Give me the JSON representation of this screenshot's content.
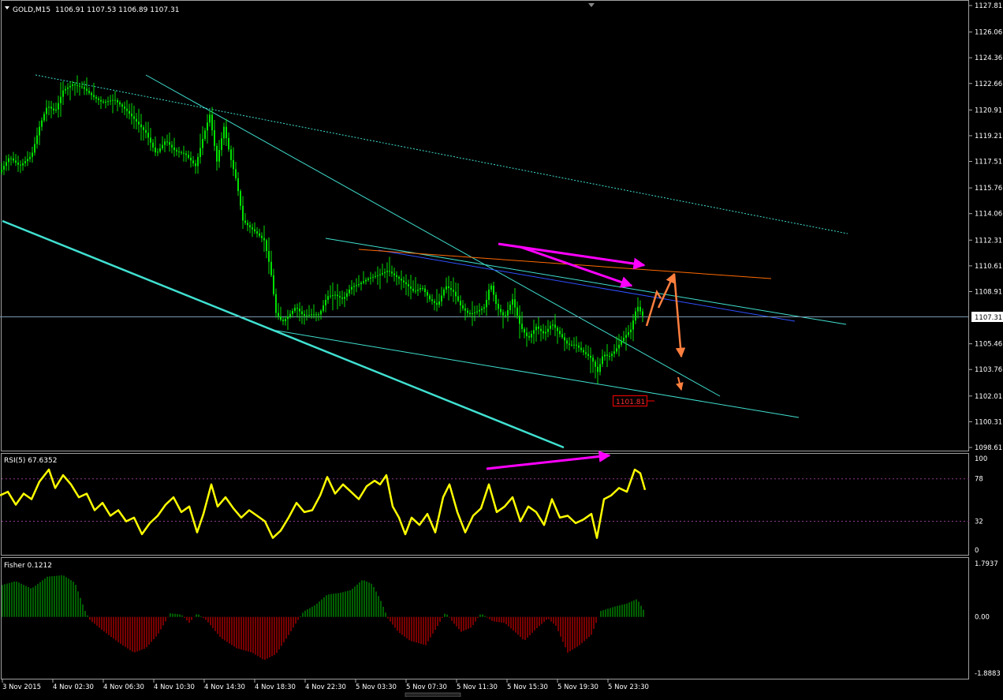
{
  "header": {
    "symbol": "GOLD,M15",
    "ohlc": "1106.91 1107.53 1106.89 1107.31"
  },
  "price_axis": {
    "ticks": [
      "1127.81",
      "1126.06",
      "1124.36",
      "1122.66",
      "1120.91",
      "1119.21",
      "1117.51",
      "1115.76",
      "1114.06",
      "1112.31",
      "1110.61",
      "1108.91",
      "1105.46",
      "1103.76",
      "1102.01",
      "1100.31",
      "1098.61"
    ],
    "current_price_label": "1107.31"
  },
  "time_axis": {
    "labels": [
      "3 Nov 2015",
      "4 Nov 02:30",
      "4 Nov 06:30",
      "4 Nov 10:30",
      "4 Nov 14:30",
      "4 Nov 18:30",
      "4 Nov 22:30",
      "5 Nov 03:30",
      "5 Nov 07:30",
      "5 Nov 11:30",
      "5 Nov 15:30",
      "5 Nov 19:30",
      "5 Nov 23:30"
    ]
  },
  "rsi_panel": {
    "title": "RSI(5) 67.6352",
    "ticks": [
      "100",
      "78",
      "32",
      "0"
    ],
    "levels": [
      78,
      32
    ]
  },
  "fisher_panel": {
    "title": "Fisher 0.1212",
    "ticks": [
      "1.7937",
      "0.00",
      "-1.8883"
    ]
  },
  "annotations": {
    "target_label": "1101.81"
  },
  "colors": {
    "background": "#000000",
    "candle": "#00e000",
    "rsi_line": "#ffff00",
    "fisher_positive": "#00a000",
    "fisher_negative": "#cc0000",
    "trendline_cyan": "#40e0d0",
    "trendline_blue": "#3050ff",
    "trendline_orange": "#ff6a00",
    "arrow_magenta": "#ff00ff",
    "arrow_orange": "#ff7f3f",
    "level_box": "#ff0000"
  },
  "chart_data": {
    "type": "candlestick",
    "title": "GOLD,M15",
    "ylim": [
      1098.61,
      1127.81
    ],
    "close_trace": [
      [
        0,
        1116.8
      ],
      [
        12,
        1117.8
      ],
      [
        25,
        1117.2
      ],
      [
        40,
        1117.9
      ],
      [
        50,
        1119.8
      ],
      [
        60,
        1121.2
      ],
      [
        70,
        1120.8
      ],
      [
        80,
        1122.2
      ],
      [
        92,
        1122.6
      ],
      [
        105,
        1122.4
      ],
      [
        118,
        1121.8
      ],
      [
        130,
        1121.4
      ],
      [
        145,
        1121.6
      ],
      [
        160,
        1120.9
      ],
      [
        172,
        1120.2
      ],
      [
        185,
        1119.4
      ],
      [
        198,
        1118.0
      ],
      [
        210,
        1118.9
      ],
      [
        222,
        1118.2
      ],
      [
        235,
        1118.0
      ],
      [
        248,
        1117.2
      ],
      [
        258,
        1119.2
      ],
      [
        266,
        1120.6
      ],
      [
        275,
        1117.5
      ],
      [
        284,
        1119.8
      ],
      [
        292,
        1117.8
      ],
      [
        300,
        1116.2
      ],
      [
        308,
        1113.6
      ],
      [
        316,
        1113.2
      ],
      [
        325,
        1112.8
      ],
      [
        335,
        1112.3
      ],
      [
        343,
        1110.4
      ],
      [
        350,
        1107.5
      ],
      [
        358,
        1106.9
      ],
      [
        366,
        1107.3
      ],
      [
        375,
        1107.9
      ],
      [
        385,
        1107.3
      ],
      [
        395,
        1107.4
      ],
      [
        405,
        1107.4
      ],
      [
        415,
        1108.6
      ],
      [
        425,
        1108.7
      ],
      [
        435,
        1108.4
      ],
      [
        445,
        1109.2
      ],
      [
        455,
        1109.4
      ],
      [
        468,
        1109.8
      ],
      [
        480,
        1110.0
      ],
      [
        492,
        1110.3
      ],
      [
        505,
        1109.8
      ],
      [
        515,
        1109.4
      ],
      [
        525,
        1108.9
      ],
      [
        535,
        1109.2
      ],
      [
        545,
        1108.4
      ],
      [
        555,
        1108.0
      ],
      [
        565,
        1109.3
      ],
      [
        575,
        1108.9
      ],
      [
        585,
        1107.9
      ],
      [
        595,
        1107.4
      ],
      [
        605,
        1107.6
      ],
      [
        615,
        1107.9
      ],
      [
        622,
        1109.5
      ],
      [
        630,
        1107.9
      ],
      [
        640,
        1107.2
      ],
      [
        650,
        1108.4
      ],
      [
        660,
        1106.6
      ],
      [
        670,
        1105.8
      ],
      [
        680,
        1106.6
      ],
      [
        690,
        1106.1
      ],
      [
        700,
        1106.8
      ],
      [
        710,
        1106.1
      ],
      [
        720,
        1105.4
      ],
      [
        730,
        1105.4
      ],
      [
        740,
        1104.9
      ],
      [
        750,
        1104.5
      ],
      [
        758,
        1103.6
      ],
      [
        765,
        1104.8
      ],
      [
        772,
        1104.6
      ],
      [
        780,
        1105.0
      ],
      [
        790,
        1105.8
      ],
      [
        800,
        1106.4
      ],
      [
        808,
        1108.0
      ],
      [
        815,
        1107.3
      ]
    ],
    "rsi": {
      "name": "RSI(5)",
      "last_value": 67.6352,
      "ylim": [
        0,
        100
      ],
      "levels": [
        78,
        32
      ],
      "trace": [
        [
          0,
          60
        ],
        [
          10,
          64
        ],
        [
          20,
          50
        ],
        [
          30,
          62
        ],
        [
          40,
          56
        ],
        [
          50,
          75
        ],
        [
          62,
          88
        ],
        [
          70,
          68
        ],
        [
          80,
          82
        ],
        [
          90,
          72
        ],
        [
          100,
          58
        ],
        [
          110,
          62
        ],
        [
          120,
          44
        ],
        [
          130,
          52
        ],
        [
          140,
          38
        ],
        [
          150,
          44
        ],
        [
          160,
          32
        ],
        [
          170,
          36
        ],
        [
          180,
          18
        ],
        [
          190,
          30
        ],
        [
          200,
          38
        ],
        [
          210,
          50
        ],
        [
          220,
          58
        ],
        [
          230,
          42
        ],
        [
          240,
          48
        ],
        [
          250,
          20
        ],
        [
          258,
          40
        ],
        [
          268,
          72
        ],
        [
          276,
          48
        ],
        [
          286,
          58
        ],
        [
          296,
          46
        ],
        [
          306,
          36
        ],
        [
          316,
          44
        ],
        [
          326,
          38
        ],
        [
          336,
          32
        ],
        [
          346,
          14
        ],
        [
          356,
          22
        ],
        [
          366,
          36
        ],
        [
          376,
          52
        ],
        [
          386,
          42
        ],
        [
          396,
          44
        ],
        [
          406,
          60
        ],
        [
          415,
          80
        ],
        [
          425,
          62
        ],
        [
          435,
          72
        ],
        [
          445,
          64
        ],
        [
          455,
          56
        ],
        [
          465,
          70
        ],
        [
          475,
          76
        ],
        [
          482,
          72
        ],
        [
          490,
          82
        ],
        [
          498,
          48
        ],
        [
          506,
          36
        ],
        [
          514,
          18
        ],
        [
          522,
          36
        ],
        [
          532,
          28
        ],
        [
          542,
          40
        ],
        [
          552,
          20
        ],
        [
          562,
          58
        ],
        [
          570,
          72
        ],
        [
          580,
          42
        ],
        [
          590,
          20
        ],
        [
          600,
          38
        ],
        [
          610,
          46
        ],
        [
          620,
          72
        ],
        [
          630,
          42
        ],
        [
          640,
          48
        ],
        [
          650,
          58
        ],
        [
          660,
          32
        ],
        [
          670,
          48
        ],
        [
          680,
          42
        ],
        [
          690,
          28
        ],
        [
          700,
          56
        ],
        [
          710,
          36
        ],
        [
          720,
          38
        ],
        [
          730,
          30
        ],
        [
          740,
          34
        ],
        [
          750,
          40
        ],
        [
          757,
          14
        ],
        [
          766,
          56
        ],
        [
          775,
          60
        ],
        [
          785,
          68
        ],
        [
          795,
          64
        ],
        [
          805,
          88
        ],
        [
          812,
          84
        ],
        [
          818,
          66
        ]
      ]
    },
    "fisher": {
      "name": "Fisher",
      "last_value": 0.1212,
      "ylim": [
        -1.8883,
        1.7937
      ],
      "trace": [
        [
          0,
          1.05
        ],
        [
          20,
          1.2
        ],
        [
          40,
          0.95
        ],
        [
          60,
          1.35
        ],
        [
          80,
          1.4
        ],
        [
          95,
          1.15
        ],
        [
          108,
          0.2
        ],
        [
          114,
          -0.1
        ],
        [
          130,
          -0.45
        ],
        [
          150,
          -0.85
        ],
        [
          170,
          -1.2
        ],
        [
          185,
          -1.05
        ],
        [
          200,
          -0.6
        ],
        [
          210,
          -0.15
        ],
        [
          216,
          0.12
        ],
        [
          230,
          0.08
        ],
        [
          240,
          -0.2
        ],
        [
          250,
          0.12
        ],
        [
          262,
          -0.12
        ],
        [
          280,
          -0.7
        ],
        [
          300,
          -1.05
        ],
        [
          320,
          -1.2
        ],
        [
          335,
          -1.45
        ],
        [
          350,
          -1.25
        ],
        [
          365,
          -0.65
        ],
        [
          378,
          -0.1
        ],
        [
          385,
          0.18
        ],
        [
          400,
          0.4
        ],
        [
          415,
          0.75
        ],
        [
          430,
          0.8
        ],
        [
          445,
          0.9
        ],
        [
          460,
          1.25
        ],
        [
          472,
          1.1
        ],
        [
          482,
          0.6
        ],
        [
          492,
          -0.05
        ],
        [
          505,
          -0.5
        ],
        [
          520,
          -0.8
        ],
        [
          540,
          -0.95
        ],
        [
          555,
          -0.3
        ],
        [
          565,
          0.15
        ],
        [
          575,
          -0.2
        ],
        [
          585,
          -0.5
        ],
        [
          598,
          -0.35
        ],
        [
          610,
          0.12
        ],
        [
          625,
          -0.15
        ],
        [
          640,
          -0.2
        ],
        [
          655,
          -0.55
        ],
        [
          665,
          -0.8
        ],
        [
          680,
          -0.4
        ],
        [
          695,
          -0.05
        ],
        [
          705,
          -0.3
        ],
        [
          720,
          -1.2
        ],
        [
          735,
          -0.95
        ],
        [
          750,
          -0.6
        ],
        [
          762,
          0.2
        ],
        [
          780,
          0.35
        ],
        [
          795,
          0.45
        ],
        [
          808,
          0.6
        ],
        [
          818,
          0.15
        ]
      ]
    }
  }
}
